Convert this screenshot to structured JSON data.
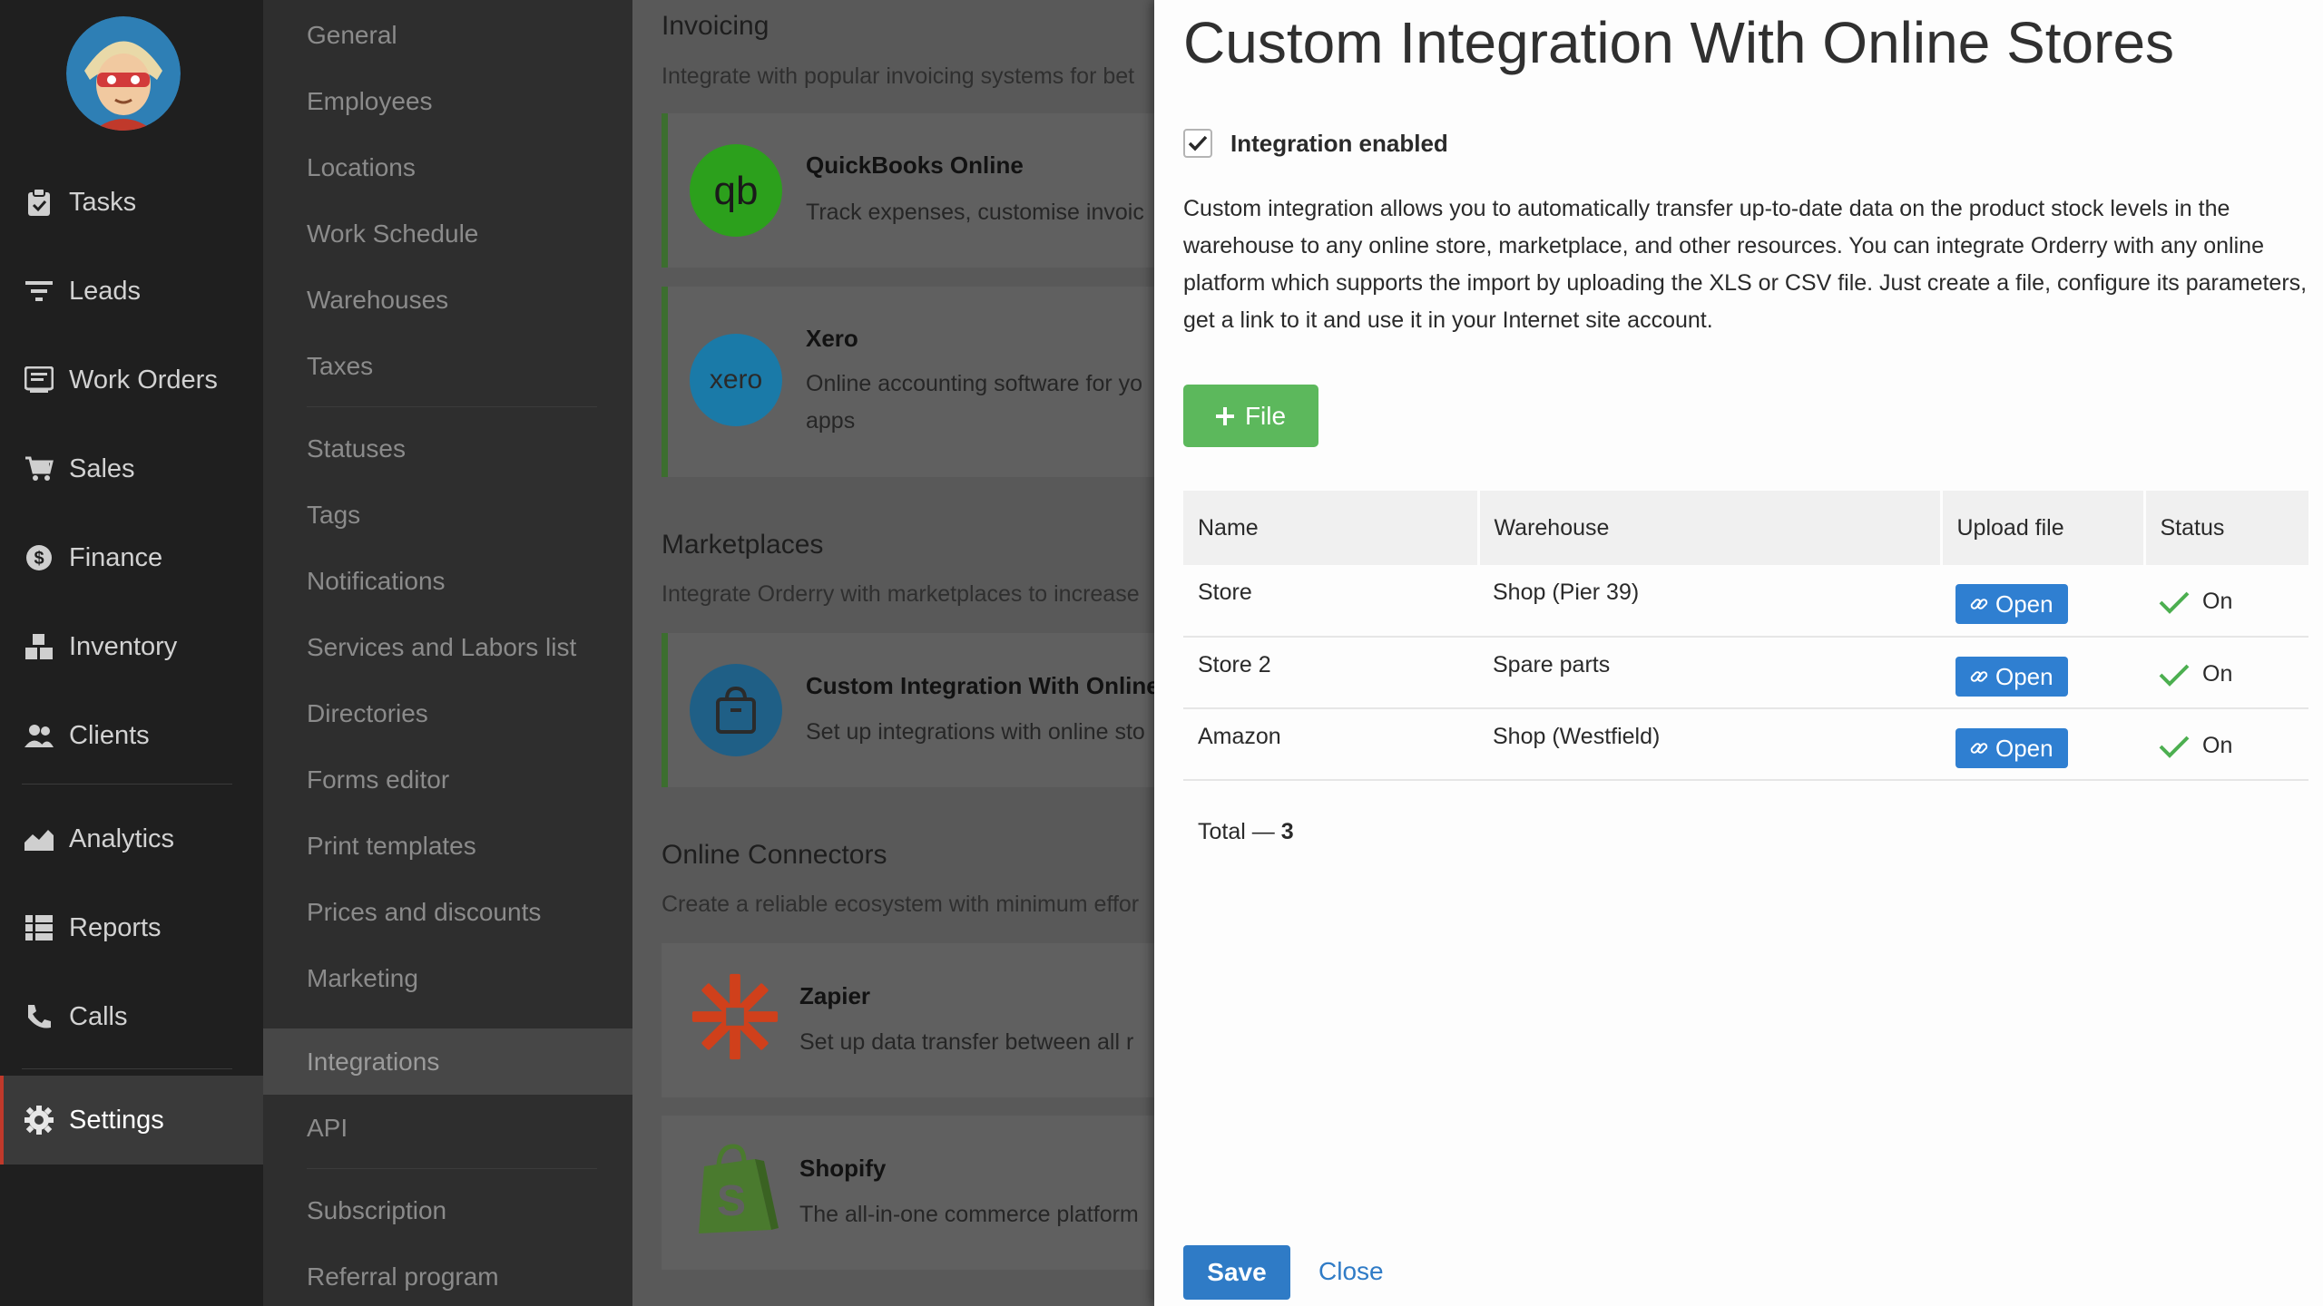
{
  "nav": {
    "items": [
      {
        "label": "Tasks",
        "icon": "clipboard-icon"
      },
      {
        "label": "Leads",
        "icon": "funnel-icon"
      },
      {
        "label": "Work Orders",
        "icon": "work-order-icon"
      },
      {
        "label": "Sales",
        "icon": "cart-icon"
      },
      {
        "label": "Finance",
        "icon": "dollar-icon"
      },
      {
        "label": "Inventory",
        "icon": "boxes-icon"
      },
      {
        "label": "Clients",
        "icon": "users-icon"
      },
      {
        "label": "Analytics",
        "icon": "chart-icon"
      },
      {
        "label": "Reports",
        "icon": "list-icon"
      },
      {
        "label": "Calls",
        "icon": "phone-icon"
      },
      {
        "label": "Settings",
        "icon": "gear-icon"
      }
    ],
    "active": "Settings"
  },
  "submenu": {
    "items": [
      "General",
      "Employees",
      "Locations",
      "Work Schedule",
      "Warehouses",
      "Taxes",
      "Statuses",
      "Tags",
      "Notifications",
      "Services and Labors list",
      "Directories",
      "Forms editor",
      "Print templates",
      "Prices and discounts",
      "Marketing",
      "Integrations",
      "API",
      "Subscription",
      "Referral program"
    ],
    "active": "Integrations"
  },
  "content": {
    "invoicing": {
      "title": "Invoicing",
      "desc": "Integrate with popular invoicing systems for bet",
      "cards": [
        {
          "title": "QuickBooks Online",
          "desc1": "Track expenses, customise invoic",
          "desc2": ""
        },
        {
          "title": "Xero",
          "desc1": "Online accounting software for yo",
          "desc2": "apps"
        }
      ]
    },
    "marketplaces": {
      "title": "Marketplaces",
      "desc": "Integrate Orderry with marketplaces to increase",
      "cards": [
        {
          "title": "Custom Integration With Online",
          "desc1": "Set up integrations with online sto",
          "desc2": ""
        }
      ]
    },
    "connectors": {
      "title": "Online Connectors",
      "desc": "Create a reliable ecosystem with minimum effor",
      "cards": [
        {
          "title": "Zapier",
          "desc1": "Set up data transfer between all r",
          "desc2": ""
        },
        {
          "title": "Shopify",
          "desc1": "The all-in-one commerce platform",
          "desc2": ""
        }
      ]
    }
  },
  "panel": {
    "title": "Custom Integration With Online Stores",
    "checkbox_label": "Integration enabled",
    "checkbox_checked": true,
    "description": "Custom integration allows you to automatically transfer up-to-date data on the product stock levels in the warehouse to any online store, marketplace, and other resources. You can integrate Orderry with any online platform which supports the import by uploading the XLS or CSV file. Just create a file, configure its parameters, get a link to it and use it in your Internet site account.",
    "file_button": "File",
    "table": {
      "headers": [
        "Name",
        "Warehouse",
        "Upload file",
        "Status"
      ],
      "rows": [
        {
          "name": "Store",
          "warehouse": "Shop (Pier 39)",
          "upload": "Open",
          "status": "On"
        },
        {
          "name": "Store 2",
          "warehouse": "Spare parts",
          "upload": "Open",
          "status": "On"
        },
        {
          "name": "Amazon",
          "warehouse": "Shop (Westfield)",
          "upload": "Open",
          "status": "On"
        }
      ]
    },
    "total_label": "Total —",
    "total_value": "3",
    "save_label": "Save",
    "close_label": "Close"
  },
  "colors": {
    "accent_green": "#5cb85c",
    "accent_blue": "#2f7fd1",
    "nav_active_marker": "#c0392b"
  }
}
